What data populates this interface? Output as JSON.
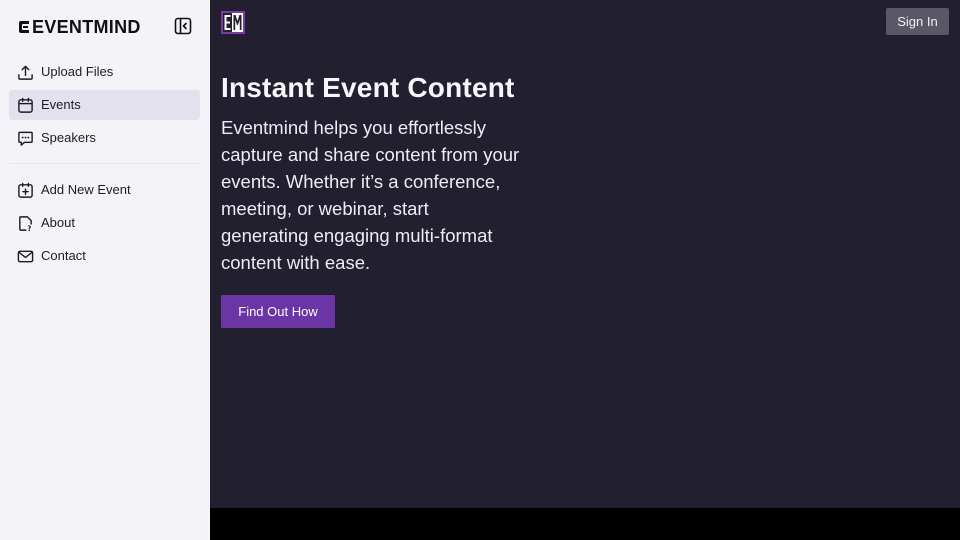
{
  "brand": {
    "name": "EVENTMIND"
  },
  "sidebar": {
    "primary_items": [
      {
        "label": "Upload Files",
        "icon": "upload-icon"
      },
      {
        "label": "Events",
        "icon": "calendar-icon",
        "active": true
      },
      {
        "label": "Speakers",
        "icon": "message-icon"
      }
    ],
    "secondary_items": [
      {
        "label": "Add New Event",
        "icon": "calendar-plus-icon"
      },
      {
        "label": "About",
        "icon": "info-file-icon"
      },
      {
        "label": "Contact",
        "icon": "mail-icon"
      }
    ]
  },
  "header": {
    "logo_text": "EM",
    "signin_label": "Sign In"
  },
  "hero": {
    "title": "Instant Event Content",
    "description": "Eventmind helps you effortlessly capture and share content from your events. Whether it’s a conference, meeting, or webinar, start generating engaging multi-format content with ease.",
    "cta_label": "Find Out How"
  },
  "colors": {
    "sidebar_bg": "#f4f4f8",
    "main_bg": "#221f2f",
    "accent": "#6b35a6",
    "signin_bg": "#5a5766",
    "active_item_bg": "#e4e1ee"
  }
}
